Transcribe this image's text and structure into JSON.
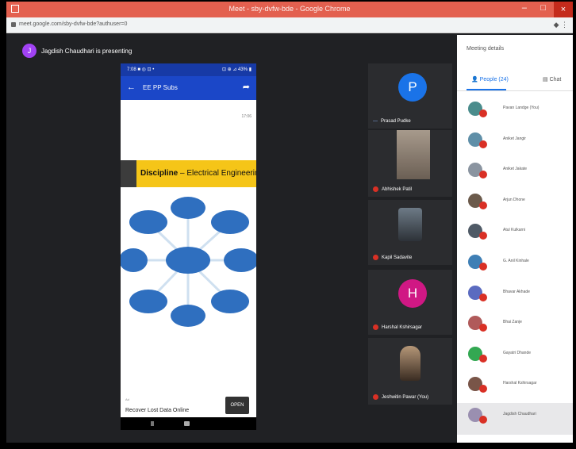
{
  "browser": {
    "title": "Meet - sby-dvfw-bde - Google Chrome",
    "url": "meet.google.com/sby-dvfw-bde?authuser=0"
  },
  "presenter": {
    "avatar_letter": "J",
    "text": "Jagdish Chaudhari is presenting"
  },
  "phone": {
    "status_left": "7:08 ■ ◎ ⊡ •",
    "status_right": "⊡ ⊕ ⊿ 43% ▮",
    "app_title": "EE PP Subs",
    "date_text": "17:06",
    "banner_bold": "Discipline",
    "banner_rest": " – Electrical Engineering",
    "ad_label": "Ad",
    "ad_text": "Recover Lost Data Online",
    "ad_button": "OPEN"
  },
  "tiles": [
    {
      "letter": "P",
      "color": "#1a73e8",
      "label": "Prasad Pudke"
    },
    {
      "label": "Abhishek Patil"
    },
    {
      "label": "Kapil Sadavite"
    },
    {
      "letter": "H",
      "color": "#d01884",
      "label": "Harshal Kshirsagar"
    },
    {
      "label": "Jeshwitin Pawar (You)"
    }
  ],
  "panel": {
    "title": "Meeting details",
    "close_icon": "×",
    "tab_people": "People (24)",
    "tab_chat": "Chat",
    "people": [
      {
        "name": "Pavan Landge (You)",
        "color": "#4a8c8c"
      },
      {
        "name": "Aniket Jangir",
        "color": "#5f8fa8"
      },
      {
        "name": "Aniket Jakate",
        "color": "#8a94a0"
      },
      {
        "name": "Arjun Dhone",
        "color": "#6b5a4b"
      },
      {
        "name": "Atul Kulkarni",
        "color": "#4f5a66"
      },
      {
        "name": "G. Anil Kinhale",
        "color": "#3f7fb5"
      },
      {
        "name": "Bhavar Akhade",
        "color": "#5b6bc0"
      },
      {
        "name": "Bhai Zanje",
        "color": "#b05a5a"
      },
      {
        "name": "Gayatri Dhande",
        "color": "#33a852"
      },
      {
        "name": "Harshal Kshirsagar",
        "color": "#795548"
      },
      {
        "name": "Jagdish Chaudhari",
        "color": "#9a8fb0"
      }
    ]
  }
}
